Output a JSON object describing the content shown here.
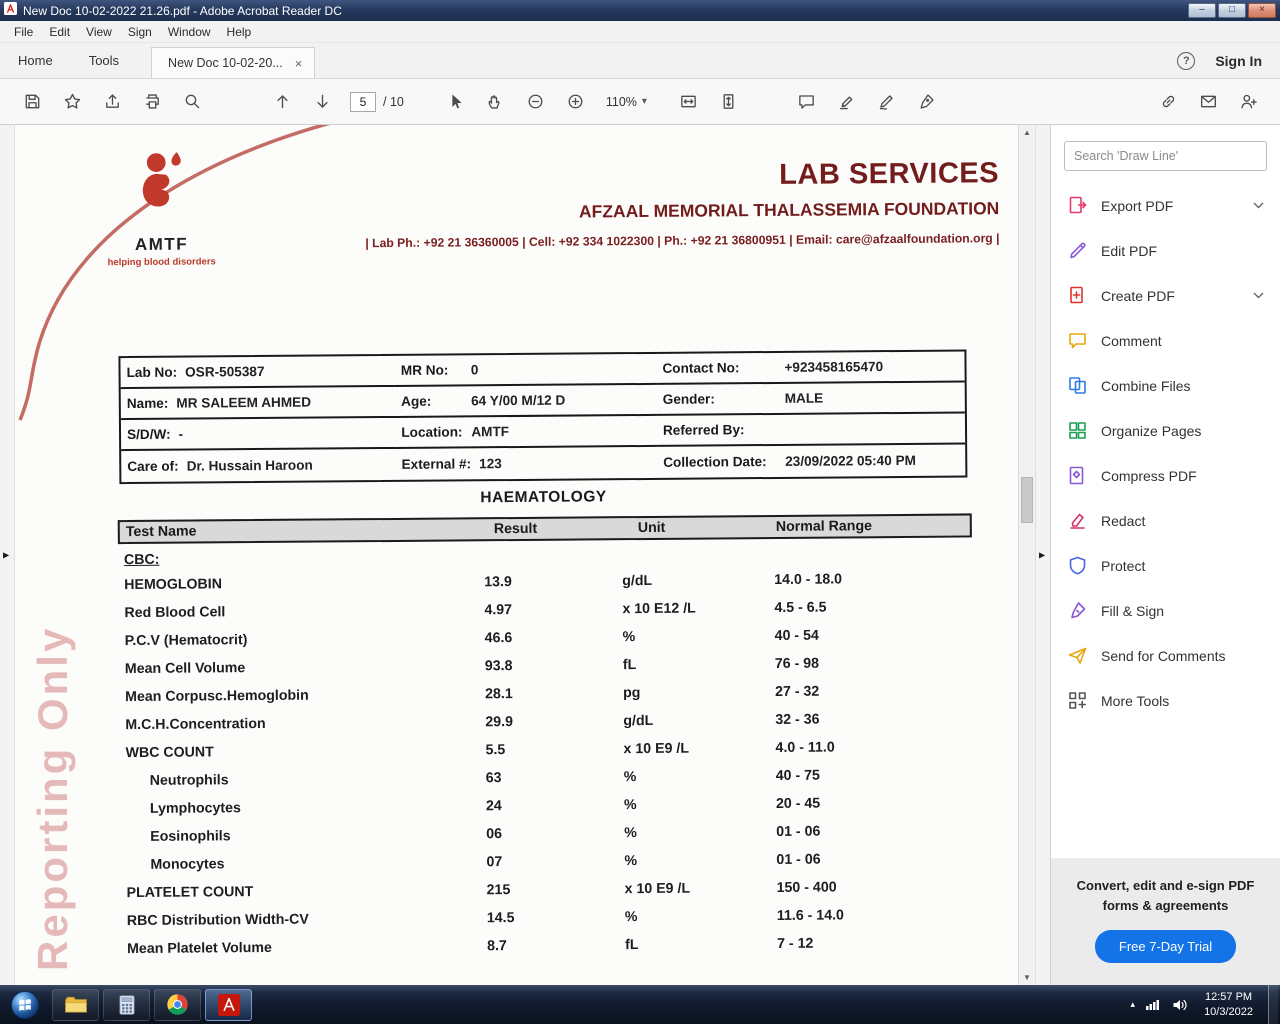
{
  "window": {
    "title": "New Doc 10-02-2022 21.26.pdf - Adobe Acrobat Reader DC",
    "menu": [
      "File",
      "Edit",
      "View",
      "Sign",
      "Window",
      "Help"
    ],
    "tabs": {
      "home": "Home",
      "tools": "Tools",
      "document": "New Doc 10-02-20..."
    },
    "sign_in": "Sign In"
  },
  "icons": {
    "help": "?",
    "minimize": "–",
    "maximize": "□",
    "close": "×",
    "tab_close": "×",
    "panel_left": "▶",
    "panel_right": "▶",
    "scroll_up": "▲",
    "scroll_down": "▼",
    "caret_down": "▾",
    "tray_caret": "▴"
  },
  "toolbar": {
    "page_current": "5",
    "page_total": "/ 10",
    "zoom_level": "110%"
  },
  "document": {
    "org": {
      "logo_text": "AMTF",
      "logo_tagline": "helping blood disorders",
      "lab_services": "LAB SERVICES",
      "foundation": "AFZAAL MEMORIAL THALASSEMIA FOUNDATION",
      "contact_line": "| Lab Ph.: +92 21 36360005 | Cell: +92 334 1022300 | Ph.: +92 21 36800951 | Email: care@afzaalfoundation.org |"
    },
    "watermark": "Reporting Only",
    "patient": {
      "lab_no_label": "Lab No:",
      "lab_no": "OSR-505387",
      "mr_no_label": "MR No:",
      "mr_no": "0",
      "contact_no_label": "Contact No:",
      "contact_no": "+923458165470",
      "name_label": "Name:",
      "name": "MR SALEEM AHMED",
      "age_label": "Age:",
      "age": "64 Y/00 M/12 D",
      "gender_label": "Gender:",
      "gender": "MALE",
      "sdw_label": "S/D/W:",
      "sdw": "-",
      "location_label": "Location:",
      "location": "AMTF",
      "referred_by_label": "Referred By:",
      "referred_by": "",
      "care_of_label": "Care of:",
      "care_of": "Dr. Hussain Haroon",
      "external_label": "External #:",
      "external": "123",
      "collection_date_label": "Collection Date:",
      "collection_date": "23/09/2022 05:40 PM"
    },
    "section_title": "HAEMATOLOGY",
    "table": {
      "headers": [
        "Test Name",
        "Result",
        "Unit",
        "Normal Range"
      ],
      "group_label": "CBC:",
      "rows": [
        {
          "name": "HEMOGLOBIN",
          "result": "13.9",
          "unit": "g/dL",
          "range": "14.0 - 18.0"
        },
        {
          "name": "Red Blood Cell",
          "result": "4.97",
          "unit": "x 10 E12 /L",
          "range": "4.5 - 6.5"
        },
        {
          "name": "P.C.V (Hematocrit)",
          "result": "46.6",
          "unit": "%",
          "range": "40 - 54"
        },
        {
          "name": "Mean Cell Volume",
          "result": "93.8",
          "unit": "fL",
          "range": "76 - 98"
        },
        {
          "name": "Mean Corpusc.Hemoglobin",
          "result": "28.1",
          "unit": "pg",
          "range": "27 - 32"
        },
        {
          "name": "M.C.H.Concentration",
          "result": "29.9",
          "unit": "g/dL",
          "range": "32 - 36"
        },
        {
          "name": "WBC COUNT",
          "result": "5.5",
          "unit": "x 10 E9 /L",
          "range": "4.0 - 11.0"
        },
        {
          "name": "Neutrophils",
          "result": "63",
          "unit": "%",
          "range": "40 - 75"
        },
        {
          "name": "Lymphocytes",
          "result": "24",
          "unit": "%",
          "range": "20 - 45"
        },
        {
          "name": "Eosinophils",
          "result": "06",
          "unit": "%",
          "range": "01 - 06"
        },
        {
          "name": "Monocytes",
          "result": "07",
          "unit": "%",
          "range": "01 - 06"
        },
        {
          "name": "PLATELET COUNT",
          "result": "215",
          "unit": "x 10 E9 /L",
          "range": "150 - 400"
        },
        {
          "name": "RBC Distribution Width-CV",
          "result": "14.5",
          "unit": "%",
          "range": "11.6 - 14.0"
        },
        {
          "name": "Mean Platelet Volume",
          "result": "8.7",
          "unit": "fL",
          "range": "7 - 12"
        }
      ]
    }
  },
  "tools_panel": {
    "search_placeholder": "Search 'Draw Line'",
    "items": [
      {
        "label": "Export PDF"
      },
      {
        "label": "Edit PDF"
      },
      {
        "label": "Create PDF"
      },
      {
        "label": "Comment"
      },
      {
        "label": "Combine Files"
      },
      {
        "label": "Organize Pages"
      },
      {
        "label": "Compress PDF"
      },
      {
        "label": "Redact"
      },
      {
        "label": "Protect"
      },
      {
        "label": "Fill & Sign"
      },
      {
        "label": "Send for Comments"
      },
      {
        "label": "More Tools"
      }
    ],
    "ad": {
      "text": "Convert, edit and e-sign PDF forms & agreements",
      "button": "Free 7-Day Trial"
    }
  },
  "taskbar": {
    "time": "12:57 PM",
    "date": "10/3/2022"
  }
}
